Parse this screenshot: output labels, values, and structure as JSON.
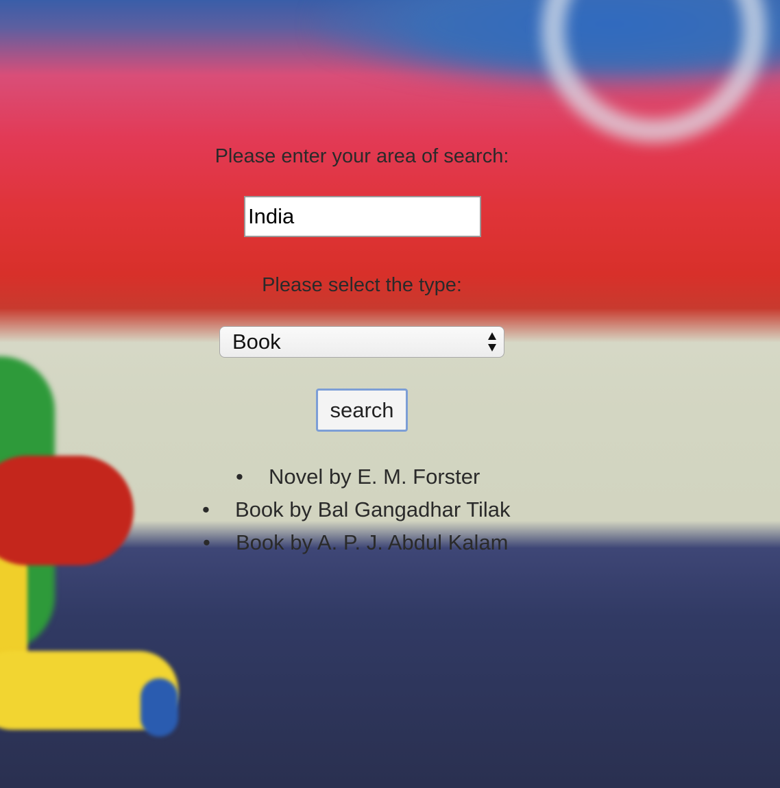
{
  "form": {
    "search_label": "Please enter your area of search:",
    "search_value": "India",
    "type_label": "Please select the type:",
    "type_selected": "Book",
    "search_button": "search"
  },
  "results": [
    "Novel by E. M. Forster",
    "Book by Bal Gangadhar Tilak",
    "Book by A. P. J. Abdul Kalam"
  ],
  "colors": {
    "button_border": "#7c9ed6",
    "text": "#2a2a2a"
  }
}
